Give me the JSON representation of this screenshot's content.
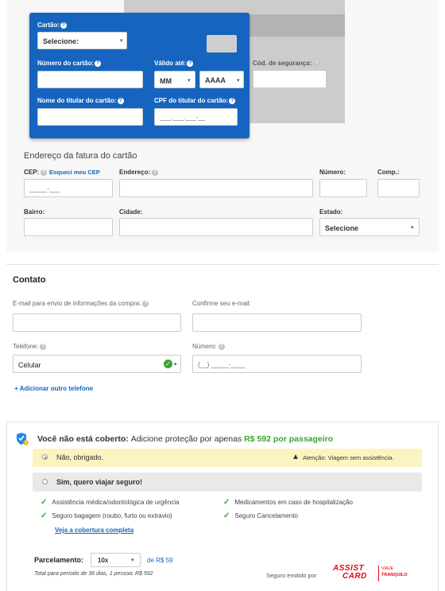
{
  "card_form": {
    "card_label": "Cartão:",
    "card_select": "Selecione:",
    "card_number_label": "Número do cartão:",
    "valid_label": "Válido até:",
    "month_value": "MM",
    "year_value": "AAAA",
    "cvv_label": "Cód. de segurança:",
    "holder_name_label": "Nome do titular do cartão:",
    "holder_cpf_label": "CPF do titular do cartão:",
    "holder_cpf_placeholder": "___.___.___-__"
  },
  "billing": {
    "title": "Endereço da fatura do cartão",
    "cep_label": "CEP:",
    "forgot_cep": "Esqueci meu CEP",
    "cep_placeholder": "_____-___",
    "address_label": "Endereço:",
    "number_label": "Número:",
    "comp_label": "Comp.:",
    "district_label": "Bairro:",
    "city_label": "Cidade:",
    "state_label": "Estado:",
    "state_value": "Selecione"
  },
  "contact": {
    "title": "Contato",
    "email_label": "E-mail para envio de informações da compra:",
    "confirm_email_label": "Confirme seu e-mail:",
    "phone_label": "Telefone:",
    "phone_type": "Celular",
    "number_label": "Número:",
    "number_placeholder": "(__) _____-____",
    "add_phone": "+ Adicionar outro telefone"
  },
  "insurance": {
    "title_start": "Você não está coberto:",
    "title_mid": "Adicione proteção por apenas",
    "price": "R$ 592",
    "title_end": "por passageiro",
    "option_no": "Não, obrigado.",
    "warning": "Atenção: Viagem sem assistência.",
    "option_yes": "Sim, quero viajar seguro!",
    "benefits": [
      "Assistência médica/odontológica de urgência",
      "Medicamentos em caso de hospitalização",
      "Seguro bagagem (roubo, furto ou extravio)",
      "Seguro Cancelamento"
    ],
    "coverage_link": "Veja a cobertura completa",
    "installments_label": "Parcelamento:",
    "installments_value": "10x",
    "installment_price": "de R$ 59",
    "total_note": "Total para período de 36 dias, 1 pessoa: R$ 592",
    "issued_by": "Seguro emitido por",
    "brand_line1": "ASSIST",
    "brand_line2": "CARD",
    "brand_tag1": "VIAJE",
    "brand_tag2": "TRANQUILO"
  },
  "colors": {
    "card_blue": "#1565c0",
    "price_green": "#3aa42d",
    "brand_red": "#e30613",
    "warning_yellow": "#fcf3c0"
  }
}
